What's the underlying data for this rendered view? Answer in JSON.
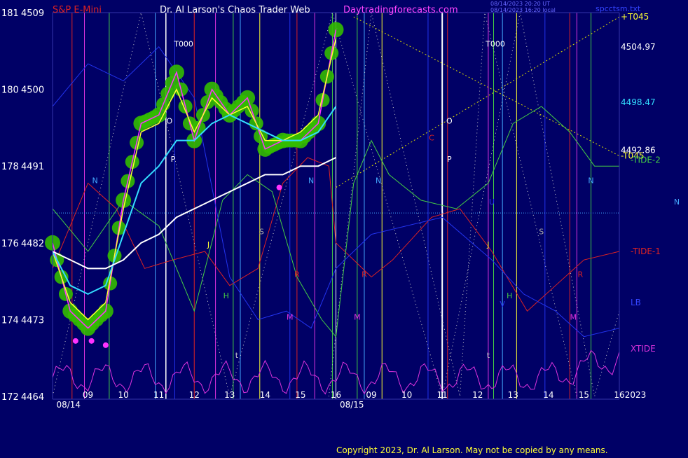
{
  "header": {
    "symbol": "S&P E-Mini",
    "site_title": "Dr. Al Larson's Chaos Trader Web",
    "site_url": "Daytradingforecasts.com",
    "timestamp_line1": "08/14/2023 20:20 UT",
    "timestamp_line2": "08/14/2023 16:20 local",
    "file_name": "spcctsm.txt"
  },
  "copyright": "Copyright 2023, Dr. Al Larson. May not be copied by any means.",
  "colors": {
    "background": "#000066",
    "plot_border": "#3333aa",
    "bar_glow": "#33bb00",
    "price_line": "#ff33ff",
    "fast_ma": "#ffff33",
    "mid_ma": "#33ddff",
    "slow_ma": "#ffffff",
    "tide1": "#dd2222",
    "tide2": "#44cc44",
    "lb": "#2233ee",
    "xtide": "#dd33dd",
    "forecast_dotted": "#cccccc",
    "fan_line": "#dddd00",
    "date_label": "#ffffff"
  },
  "chart_data": {
    "type": "line",
    "title": "S&P E-Mini",
    "y_left_outer_ticks": [
      "181",
      "180",
      "178",
      "176",
      "174",
      "172"
    ],
    "y_left_inner_ticks": [
      "4509",
      "4500",
      "4491",
      "4482",
      "4473",
      "4464"
    ],
    "y_ticks_values": [
      4509,
      4500,
      4491,
      4482,
      4473,
      4464
    ],
    "ylim": [
      4464,
      4509
    ],
    "x_hour_labels": [
      "09",
      "10",
      "11",
      "12",
      "13",
      "14",
      "15",
      "16",
      "09",
      "10",
      "11",
      "12",
      "13",
      "14",
      "15",
      "16"
    ],
    "x_date_labels": [
      "08/14",
      "08/15"
    ],
    "x_year_label": "2023",
    "hours_08_14": [
      8.0,
      8.5,
      9.0,
      9.5,
      10.0,
      10.5,
      11.0,
      11.5,
      12.0,
      12.5,
      13.0,
      13.5,
      14.0,
      14.5,
      15.0,
      15.5,
      16.0
    ],
    "price_08_14": [
      4482,
      4474,
      4472,
      4474,
      4487,
      4496,
      4497,
      4502,
      4494,
      4500,
      4497,
      4499,
      4493,
      4494,
      4494,
      4496,
      4507
    ],
    "fast_ma_08_14": [
      4481,
      4475,
      4473,
      4475,
      4486,
      4495,
      4496,
      4500,
      4495,
      4499,
      4497,
      4498,
      4494,
      4494,
      4495,
      4497,
      4506
    ],
    "mid_ma_08_14": [
      4481,
      4477,
      4476,
      4477,
      4483,
      4489,
      4491,
      4494,
      4494,
      4496,
      4497,
      4496,
      4495,
      4494,
      4494,
      4495,
      4498
    ],
    "slow_ma_08_14": [
      4481,
      4480,
      4479,
      4479,
      4480,
      4482,
      4483,
      4485,
      4486,
      4487,
      4488,
      4489,
      4490,
      4490,
      4491,
      4491,
      4492
    ],
    "right_price_labels": [
      {
        "text": "+T045",
        "value": 4508.5
      },
      {
        "text": "4504.97",
        "value": 4504.97
      },
      {
        "text": "4498.47",
        "value": 4498.47
      },
      {
        "text": "4492.86",
        "value": 4492.86
      },
      {
        "text": "-T045",
        "value": 4492.2
      }
    ],
    "right_line_labels": [
      "-TIDE-2",
      "-TIDE-1",
      "LB",
      "XTIDE"
    ],
    "right_edge_label": "N",
    "vertical_markers": [
      {
        "text": "T000",
        "hour": 11.7,
        "day": 0
      },
      {
        "text": "T000",
        "hour": 12.5,
        "day": 1
      }
    ],
    "letter_markers": [
      {
        "text": "N",
        "hour": 9.2,
        "day": 0,
        "value": 4489,
        "color": "#44aaff"
      },
      {
        "text": "O",
        "hour": 11.3,
        "day": 0,
        "value": 4496,
        "color": "#ffffff"
      },
      {
        "text": "P",
        "hour": 11.4,
        "day": 0,
        "value": 4491.5,
        "color": "#ffffff"
      },
      {
        "text": "J",
        "hour": 12.4,
        "day": 0,
        "value": 4481.5,
        "color": "#ffff33"
      },
      {
        "text": "H",
        "hour": 12.9,
        "day": 0,
        "value": 4475.5,
        "color": "#44cc44"
      },
      {
        "text": "t",
        "hour": 13.2,
        "day": 0,
        "value": 4468.5,
        "color": "#cccccc"
      },
      {
        "text": "S",
        "hour": 13.9,
        "day": 0,
        "value": 4483,
        "color": "#aaaaaa"
      },
      {
        "text": "R",
        "hour": 14.9,
        "day": 0,
        "value": 4478,
        "color": "#dd2222"
      },
      {
        "text": "M",
        "hour": 14.7,
        "day": 0,
        "value": 4473,
        "color": "#dd33dd"
      },
      {
        "text": "N",
        "hour": 15.3,
        "day": 0,
        "value": 4489,
        "color": "#44aaff"
      },
      {
        "text": "M",
        "hour": 8.6,
        "day": 1,
        "value": 4473,
        "color": "#dd33dd"
      },
      {
        "text": "R",
        "hour": 8.8,
        "day": 1,
        "value": 4478,
        "color": "#dd2222"
      },
      {
        "text": "N",
        "hour": 9.2,
        "day": 1,
        "value": 4489,
        "color": "#44aaff"
      },
      {
        "text": "C",
        "hour": 10.7,
        "day": 1,
        "value": 4494,
        "color": "#dd2222"
      },
      {
        "text": "O",
        "hour": 11.2,
        "day": 1,
        "value": 4496,
        "color": "#ffffff"
      },
      {
        "text": "P",
        "hour": 11.2,
        "day": 1,
        "value": 4491.5,
        "color": "#ffffff"
      },
      {
        "text": "U",
        "hour": 12.4,
        "day": 1,
        "value": 4486.5,
        "color": "#2233ee"
      },
      {
        "text": "J",
        "hour": 12.3,
        "day": 1,
        "value": 4481.5,
        "color": "#ffff33"
      },
      {
        "text": "H",
        "hour": 12.9,
        "day": 1,
        "value": 4475.5,
        "color": "#44cc44"
      },
      {
        "text": "V",
        "hour": 12.7,
        "day": 1,
        "value": 4474.5,
        "color": "#2233ee"
      },
      {
        "text": "t",
        "hour": 12.3,
        "day": 1,
        "value": 4468.5,
        "color": "#cccccc"
      },
      {
        "text": "S",
        "hour": 13.8,
        "day": 1,
        "value": 4483,
        "color": "#aaaaaa"
      },
      {
        "text": "R",
        "hour": 14.9,
        "day": 1,
        "value": 4478,
        "color": "#dd2222"
      },
      {
        "text": "M",
        "hour": 14.7,
        "day": 1,
        "value": 4473,
        "color": "#dd33dd"
      },
      {
        "text": "N",
        "hour": 15.2,
        "day": 1,
        "value": 4489,
        "color": "#44aaff"
      }
    ]
  }
}
